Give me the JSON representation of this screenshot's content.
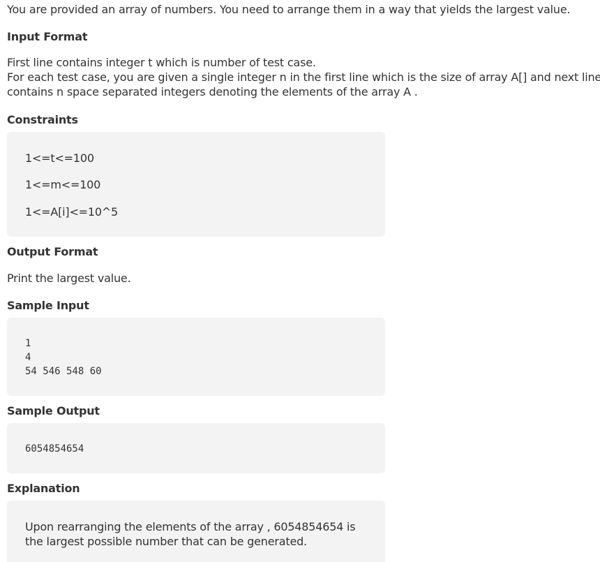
{
  "intro": "You are provided an array of numbers. You need to arrange them in a way that yields the largest value.",
  "input_format": {
    "heading": "Input Format",
    "lines": [
      "First line contains integer t which is number of test case.",
      "For each test case, you are given a single integer n in the first line which is the size of array A[] and next line",
      "contains n space separated integers denoting the elements of the array A ."
    ]
  },
  "constraints": {
    "heading": "Constraints",
    "items": [
      "1<=t<=100",
      "1<=m<=100",
      "1<=A[i]<=10^5"
    ]
  },
  "output_format": {
    "heading": "Output Format",
    "text": "Print the largest value."
  },
  "sample_input": {
    "heading": "Sample Input",
    "lines": [
      "1",
      "4",
      "54 546 548 60"
    ]
  },
  "sample_output": {
    "heading": "Sample Output",
    "value": "6054854654"
  },
  "explanation": {
    "heading": "Explanation",
    "lines": [
      "Upon rearranging the elements of the array , 6054854654 is",
      "the largest possible number that can be generated."
    ]
  }
}
